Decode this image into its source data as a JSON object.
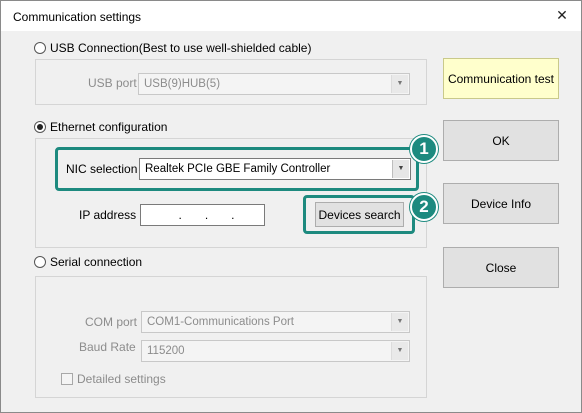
{
  "window": {
    "title": "Communication settings",
    "close_glyph": "✕"
  },
  "usb": {
    "radio_label": "USB Connection(Best to use well-shielded cable)",
    "selected": false,
    "port_label": "USB port",
    "port_value": "USB(9)HUB(5)"
  },
  "ethernet": {
    "radio_label": "Ethernet configuration",
    "selected": true,
    "nic_label": "NIC selection",
    "nic_value": "Realtek PCIe GBE Family Controller",
    "ip_label": "IP address",
    "ip_dots": [
      ".",
      ".",
      "."
    ],
    "devices_search_label": "Devices search"
  },
  "serial": {
    "radio_label": "Serial connection",
    "selected": false,
    "com_label": "COM port",
    "com_value": "COM1-Communications Port",
    "baud_label": "Baud Rate",
    "baud_value": "115200",
    "detailed_label": "Detailed settings"
  },
  "buttons": {
    "comm_test": "Communication test",
    "ok": "OK",
    "device_info": "Device Info",
    "close": "Close"
  },
  "callouts": {
    "one": "1",
    "two": "2"
  },
  "colors": {
    "accent_teal": "#1d8a7f",
    "highlight_button": "#ffffcc"
  }
}
